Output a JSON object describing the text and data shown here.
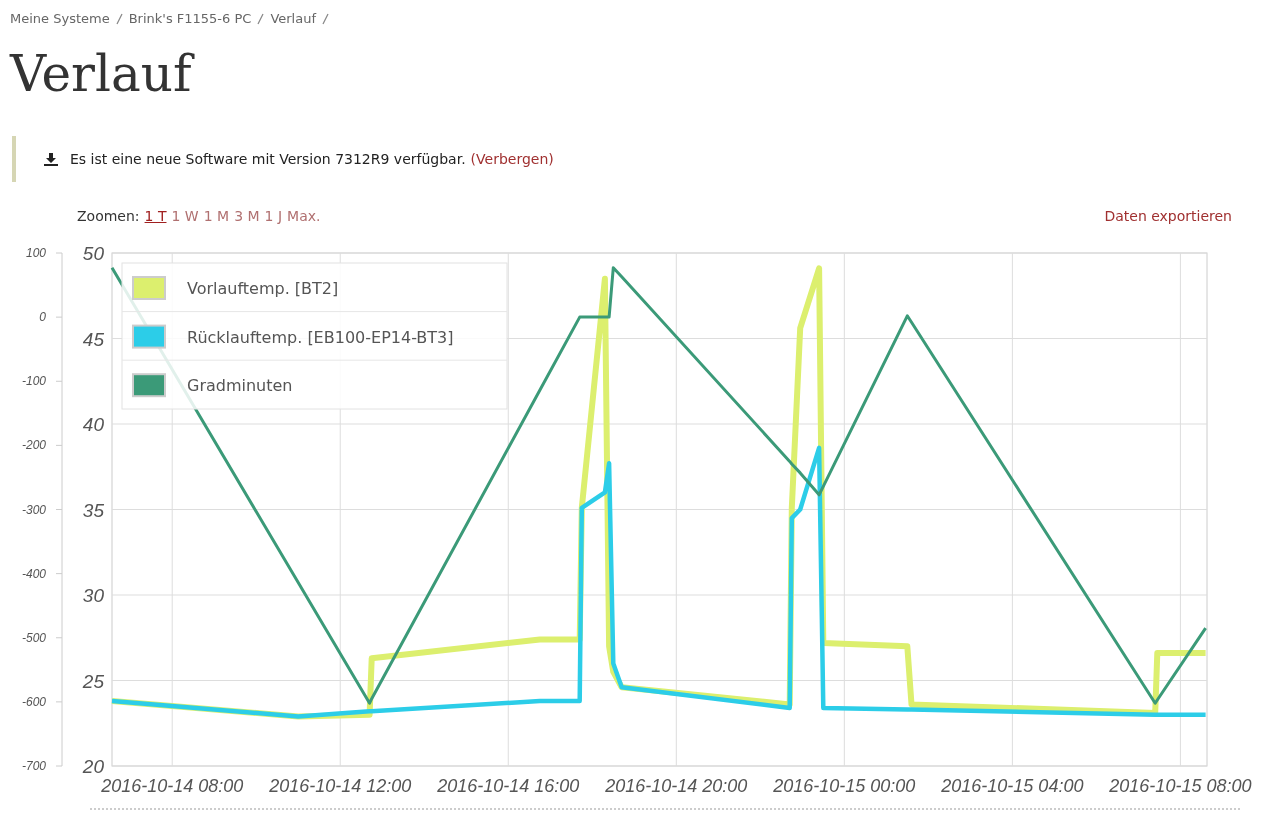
{
  "breadcrumb": [
    "Meine Systeme",
    "Brink's F1155-6 PC",
    "Verlauf"
  ],
  "title": "Verlauf",
  "notice": {
    "text": "Es ist eine neue Software mit Version 7312R9 verfügbar.",
    "link": "(Verbergen)"
  },
  "zoom": {
    "label": "Zoomen:",
    "options": [
      {
        "label": "1 T",
        "selected": true
      },
      {
        "label": "1 W",
        "selected": false
      },
      {
        "label": "1 M",
        "selected": false
      },
      {
        "label": "3 M",
        "selected": false
      },
      {
        "label": "1 J",
        "selected": false
      },
      {
        "label": "Max.",
        "selected": false
      }
    ]
  },
  "export_link": "Daten exportieren",
  "chart_data": {
    "type": "line",
    "x": [
      "2016-10-14T06:34",
      "2016-10-14T11:00",
      "2016-10-14T12:42",
      "2016-10-14T12:45",
      "2016-10-14T16:45",
      "2016-10-14T17:42",
      "2016-10-14T17:45",
      "2016-10-14T18:18",
      "2016-10-14T18:24",
      "2016-10-14T18:30",
      "2016-10-14T18:42",
      "2016-10-14T22:42",
      "2016-10-14T22:45",
      "2016-10-14T22:57",
      "2016-10-14T23:24",
      "2016-10-14T23:30",
      "2016-10-15T01:30",
      "2016-10-15T01:36",
      "2016-10-15T07:24",
      "2016-10-15T07:27",
      "2016-10-15T08:36"
    ],
    "xlim": [
      "2016-10-14T06:34",
      "2016-10-15T08:38"
    ],
    "xticks": [
      {
        "value": "2016-10-14T08:00",
        "label": "2016-10-14 08:00"
      },
      {
        "value": "2016-10-14T12:00",
        "label": "2016-10-14 12:00"
      },
      {
        "value": "2016-10-14T16:00",
        "label": "2016-10-14 16:00"
      },
      {
        "value": "2016-10-14T20:00",
        "label": "2016-10-14 20:00"
      },
      {
        "value": "2016-10-15T00:00",
        "label": "2016-10-15 00:00"
      },
      {
        "value": "2016-10-15T04:00",
        "label": "2016-10-15 04:00"
      },
      {
        "value": "2016-10-15T08:00",
        "label": "2016-10-15 08:00"
      }
    ],
    "grid": true,
    "legend": true,
    "ylim": [
      20,
      50
    ],
    "yticks": [
      20,
      25,
      30,
      35,
      40,
      45,
      50
    ],
    "y2lim": [
      -700,
      100
    ],
    "y2ticks": [
      100,
      0,
      -100,
      -200,
      -300,
      -400,
      -500,
      -600,
      -700
    ],
    "series": [
      {
        "name": "Vorlauftemp. [BT2]",
        "color": "#dcef6e",
        "values": [
          23.8,
          22.9,
          23.0,
          26.3,
          27.4,
          27.4,
          35.1,
          48.5,
          27.0,
          25.5,
          24.6,
          23.6,
          35.1,
          45.6,
          49.1,
          27.2,
          27.0,
          23.6,
          23.1,
          26.6,
          26.6
        ]
      },
      {
        "name": "Rücklauftemp. [EB100-EP14-BT3]",
        "color": "#2ccde8",
        "values": [
          23.8,
          22.9,
          23.2,
          23.2,
          23.8,
          23.8,
          35.1,
          36.0,
          37.7,
          26.0,
          24.6,
          23.4,
          34.5,
          35.0,
          38.6,
          23.4,
          23.3,
          23.3,
          23.0,
          23.0,
          23.0
        ]
      },
      {
        "name": "Gradminuten",
        "color": "#3b9a78",
        "axis": "y2",
        "values": [
          77,
          -414,
          -602,
          -595,
          -114,
          0,
          0,
          0,
          0,
          77,
          63,
          -225,
          -229,
          -243,
          -277,
          -264,
          2,
          -8,
          -602,
          -597,
          -485
        ]
      }
    ]
  }
}
